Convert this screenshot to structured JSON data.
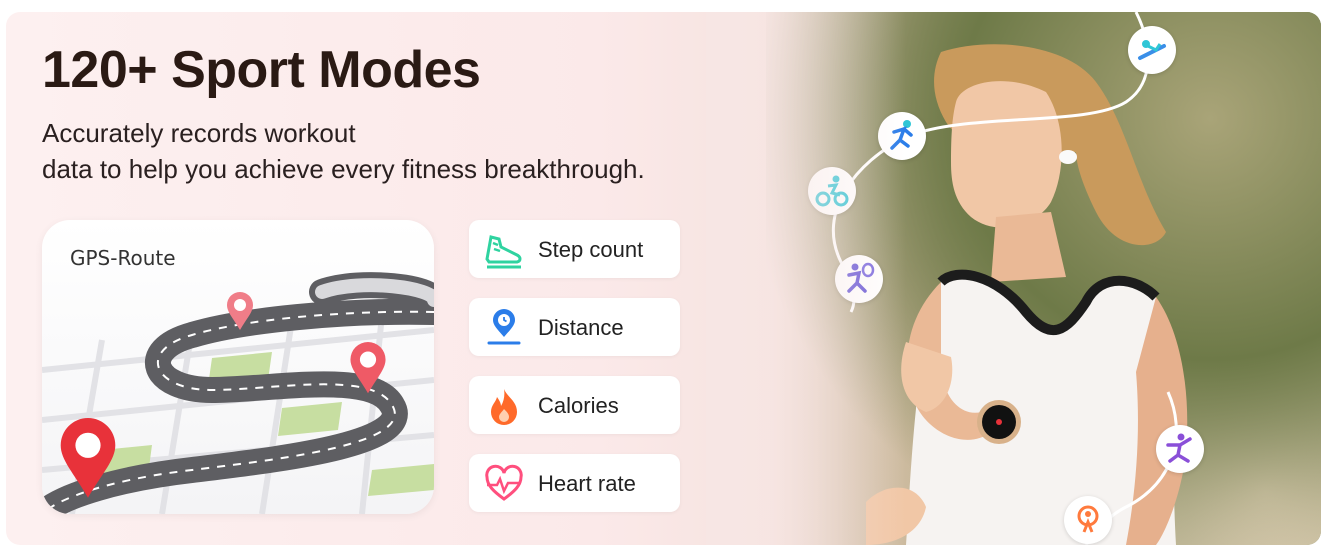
{
  "headline": "120+ Sport Modes",
  "subtitle_line1": "Accurately records workout",
  "subtitle_line2": "data to help you achieve every fitness breakthrough.",
  "map": {
    "title": "GPS-Route"
  },
  "metrics": [
    {
      "label": "Step count",
      "icon": "shoe-icon",
      "color": "#2fd3a0"
    },
    {
      "label": "Distance",
      "icon": "location-clock-icon",
      "color": "#2b7de9"
    },
    {
      "label": "Calories",
      "icon": "flame-icon",
      "color": "#ff6a2a"
    },
    {
      "label": "Heart rate",
      "icon": "heart-pulse-icon",
      "color": "#ff4f7e"
    }
  ],
  "sport_modes": [
    {
      "name": "gym-bench-icon"
    },
    {
      "name": "running-icon"
    },
    {
      "name": "cycling-icon"
    },
    {
      "name": "tennis-icon"
    },
    {
      "name": "yoga-icon"
    },
    {
      "name": "jump-rope-icon"
    }
  ],
  "colors": {
    "headline": "#2a1a14",
    "background": "#fdf0f0",
    "pin": "#e8323a",
    "pin_light": "#f07d88"
  }
}
